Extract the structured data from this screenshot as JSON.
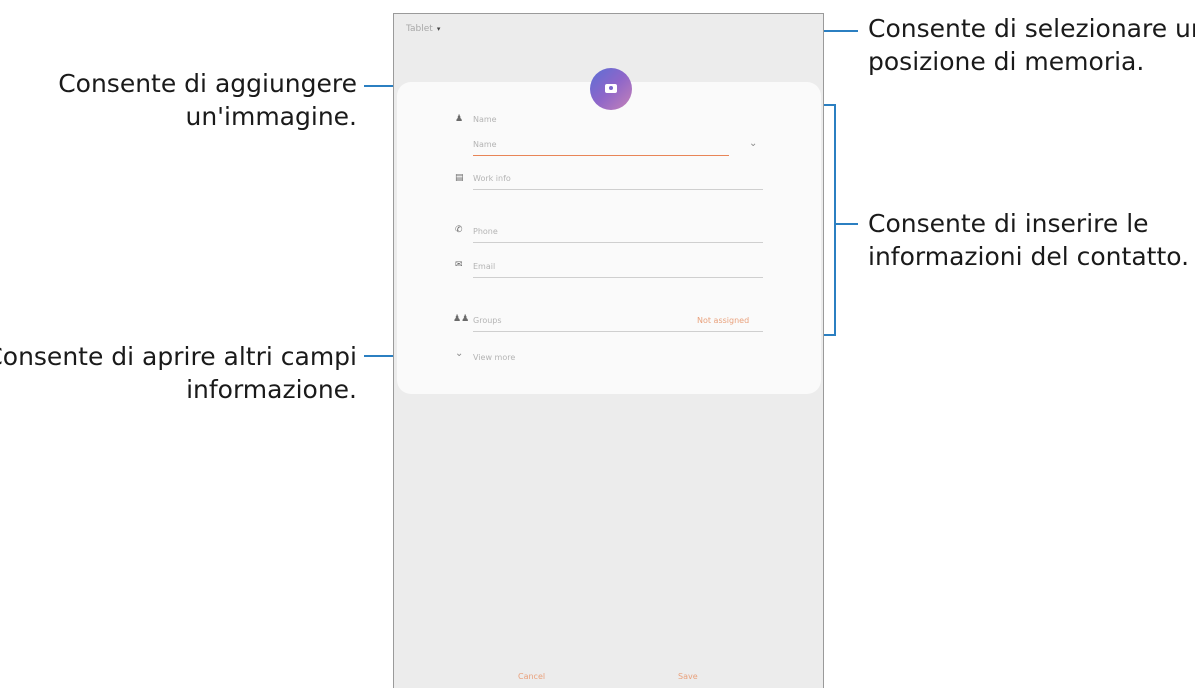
{
  "callouts": {
    "storage": {
      "line1": "Consente di selezionare una",
      "line2": "posizione di memoria."
    },
    "image": {
      "line1": "Consente di aggiungere",
      "line2": "un'immagine."
    },
    "contact_info": {
      "line1": "Consente di inserire le",
      "line2": "informazioni del contatto."
    },
    "more_fields": {
      "line1": "Consente di aprire altri campi",
      "line2": "informazione."
    }
  },
  "screen": {
    "storage_selector": {
      "label": "Tablet",
      "caret": "▾"
    },
    "avatar": {
      "icon": "camera-icon"
    },
    "fields": {
      "name_section": "Name",
      "name_placeholder": "Name",
      "work_info": "Work info",
      "phone": "Phone",
      "email": "Email",
      "groups": "Groups",
      "groups_value": "Not assigned",
      "view_more": "View more"
    },
    "buttons": {
      "cancel": "Cancel",
      "save": "Save"
    }
  },
  "colors": {
    "leader": "#2b7fc1",
    "accent": "#e88557",
    "card": "#fafafa",
    "screen_bg": "#ececec"
  }
}
